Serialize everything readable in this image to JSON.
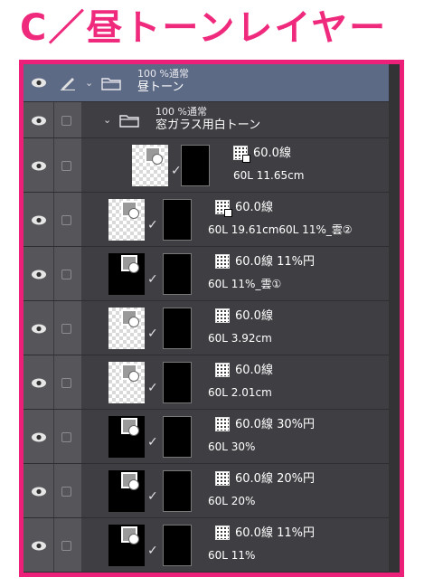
{
  "title": "C／昼トーンレイヤー",
  "colors": {
    "accent": "#ec1f79",
    "panel_bg": "#3f3f43",
    "selected_row": "#5d6a86"
  },
  "layers": [
    {
      "kind": "folder",
      "line1": "100 %通常",
      "line2": "昼トーン",
      "selected": true
    },
    {
      "kind": "folder",
      "line1": "100 %通常",
      "line2": "窓ガラス用白トーン",
      "selected": false
    },
    {
      "kind": "layer",
      "tone_label": "60.0線",
      "name": "60L 11.65cm"
    },
    {
      "kind": "layer",
      "tone_label": "60.0線",
      "name": "60L 19.61cm60L 11%_雲②"
    },
    {
      "kind": "layer",
      "tone_label": "60.0線 11%円",
      "name": "60L 11%_雲①"
    },
    {
      "kind": "layer",
      "tone_label": "60.0線",
      "name": "60L 3.92cm"
    },
    {
      "kind": "layer",
      "tone_label": "60.0線",
      "name": "60L 2.01cm"
    },
    {
      "kind": "layer",
      "tone_label": "60.0線 30%円",
      "name": "60L 30%"
    },
    {
      "kind": "layer",
      "tone_label": "60.0線 20%円",
      "name": "60L 20%"
    },
    {
      "kind": "layer",
      "tone_label": "60.0線 11%円",
      "name": "60L 11%"
    }
  ],
  "icons": [
    "eye-icon",
    "pen-icon",
    "checkbox-icon",
    "chevron-down-icon",
    "folder-icon",
    "tone-icon"
  ]
}
